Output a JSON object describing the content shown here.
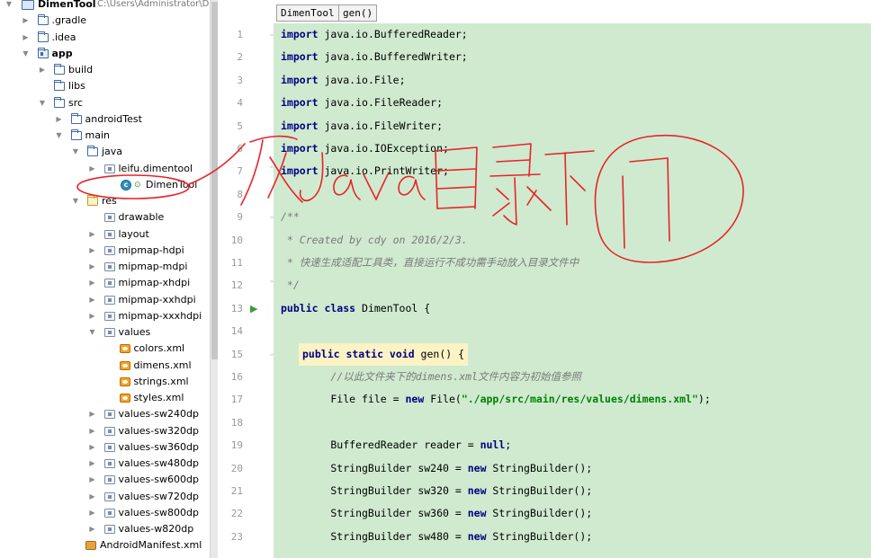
{
  "project_tree": {
    "root": {
      "label": "DimenTool",
      "path": "C:\\Users\\Administrator\\De"
    },
    "items": [
      {
        "label": ".gradle",
        "depth": 1,
        "icon": "folder-icon",
        "expanded": false
      },
      {
        "label": ".idea",
        "depth": 1,
        "icon": "folder-icon",
        "expanded": false
      },
      {
        "label": "app",
        "depth": 1,
        "icon": "module-folder-icon",
        "expanded": true,
        "bold": true
      },
      {
        "label": "build",
        "depth": 2,
        "icon": "folder-icon",
        "expanded": false
      },
      {
        "label": "libs",
        "depth": 2,
        "icon": "folder-icon",
        "expanded": null
      },
      {
        "label": "src",
        "depth": 2,
        "icon": "folder-icon",
        "expanded": true
      },
      {
        "label": "androidTest",
        "depth": 3,
        "icon": "folder-icon",
        "expanded": false
      },
      {
        "label": "main",
        "depth": 3,
        "icon": "folder-icon",
        "expanded": true
      },
      {
        "label": "java",
        "depth": 4,
        "icon": "folder-icon",
        "expanded": true
      },
      {
        "label": "leifu.dimentool",
        "depth": 5,
        "icon": "package-icon",
        "expanded": false
      },
      {
        "label": "DimenTool",
        "depth": 6,
        "icon": "class-icon",
        "expanded": null
      },
      {
        "label": "res",
        "depth": 4,
        "icon": "res-folder-icon",
        "expanded": true
      },
      {
        "label": "drawable",
        "depth": 5,
        "icon": "package-icon",
        "expanded": null
      },
      {
        "label": "layout",
        "depth": 5,
        "icon": "package-icon",
        "expanded": false
      },
      {
        "label": "mipmap-hdpi",
        "depth": 5,
        "icon": "package-icon",
        "expanded": false
      },
      {
        "label": "mipmap-mdpi",
        "depth": 5,
        "icon": "package-icon",
        "expanded": false
      },
      {
        "label": "mipmap-xhdpi",
        "depth": 5,
        "icon": "package-icon",
        "expanded": false
      },
      {
        "label": "mipmap-xxhdpi",
        "depth": 5,
        "icon": "package-icon",
        "expanded": false
      },
      {
        "label": "mipmap-xxxhdpi",
        "depth": 5,
        "icon": "package-icon",
        "expanded": false
      },
      {
        "label": "values",
        "depth": 5,
        "icon": "package-icon",
        "expanded": true
      },
      {
        "label": "colors.xml",
        "depth": 7,
        "icon": "xml-file-icon",
        "expanded": null
      },
      {
        "label": "dimens.xml",
        "depth": 7,
        "icon": "xml-file-icon",
        "expanded": null
      },
      {
        "label": "strings.xml",
        "depth": 7,
        "icon": "xml-file-icon",
        "expanded": null
      },
      {
        "label": "styles.xml",
        "depth": 7,
        "icon": "xml-file-icon",
        "expanded": null
      },
      {
        "label": "values-sw240dp",
        "depth": 5,
        "icon": "package-icon",
        "expanded": false
      },
      {
        "label": "values-sw320dp",
        "depth": 5,
        "icon": "package-icon",
        "expanded": false
      },
      {
        "label": "values-sw360dp",
        "depth": 5,
        "icon": "package-icon",
        "expanded": false
      },
      {
        "label": "values-sw480dp",
        "depth": 5,
        "icon": "package-icon",
        "expanded": false
      },
      {
        "label": "values-sw600dp",
        "depth": 5,
        "icon": "package-icon",
        "expanded": false
      },
      {
        "label": "values-sw720dp",
        "depth": 5,
        "icon": "package-icon",
        "expanded": false
      },
      {
        "label": "values-sw800dp",
        "depth": 5,
        "icon": "package-icon",
        "expanded": false
      },
      {
        "label": "values-w820dp",
        "depth": 5,
        "icon": "package-icon",
        "expanded": false
      },
      {
        "label": "AndroidManifest.xml",
        "depth": 4,
        "icon": "manifest-file-icon",
        "expanded": null
      }
    ]
  },
  "breadcrumb": {
    "class_name": "DimenTool",
    "method_name": "gen()"
  },
  "editor": {
    "lines": [
      {
        "n": "1",
        "tokens": [
          [
            "kw",
            "import"
          ],
          [
            "",
            "java.io.BufferedReader;"
          ]
        ]
      },
      {
        "n": "2",
        "tokens": [
          [
            "kw",
            "import"
          ],
          [
            "",
            "java.io.BufferedWriter;"
          ]
        ]
      },
      {
        "n": "3",
        "tokens": [
          [
            "kw",
            "import"
          ],
          [
            "",
            "java.io.File;"
          ]
        ]
      },
      {
        "n": "4",
        "tokens": [
          [
            "kw",
            "import"
          ],
          [
            "",
            "java.io.FileReader;"
          ]
        ]
      },
      {
        "n": "5",
        "tokens": [
          [
            "kw",
            "import"
          ],
          [
            "",
            "java.io.FileWriter;"
          ]
        ]
      },
      {
        "n": "6",
        "tokens": [
          [
            "kw",
            "import"
          ],
          [
            "",
            "java.io.IOException;"
          ]
        ]
      },
      {
        "n": "7",
        "tokens": [
          [
            "kw",
            "import"
          ],
          [
            "",
            "java.io.PrintWriter;"
          ]
        ]
      },
      {
        "n": "8",
        "tokens": []
      },
      {
        "n": "9",
        "tokens": [
          [
            "cm",
            "/**"
          ]
        ]
      },
      {
        "n": "10",
        "tokens": [
          [
            "cm",
            " * Created by cdy on 2016/2/3."
          ]
        ]
      },
      {
        "n": "11",
        "tokens": [
          [
            "cm",
            " * 快速生成适配工具类，直接运行不成功需手动放入目录文件中"
          ]
        ]
      },
      {
        "n": "12",
        "tokens": [
          [
            "cm",
            " */"
          ]
        ]
      },
      {
        "n": "13",
        "tokens": [
          [
            "kw",
            "public class"
          ],
          [
            "",
            " DimenTool {"
          ]
        ]
      },
      {
        "n": "14",
        "tokens": []
      },
      {
        "n": "15",
        "tokens": [
          [
            "kw",
            "public static void"
          ],
          [
            "",
            " gen() {"
          ]
        ],
        "highlight": true
      },
      {
        "n": "16",
        "tokens": [
          [
            "",
            "        "
          ],
          [
            "cm",
            "//以此文件夹下的dimens.xml文件内容为初始值参照"
          ]
        ]
      },
      {
        "n": "17",
        "tokens": [
          [
            "",
            "        File file = "
          ],
          [
            "kw",
            "new"
          ],
          [
            "",
            " File("
          ],
          [
            "str",
            "\"./app/src/main/res/values/dimens.xml\""
          ],
          [
            "",
            ");"
          ]
        ]
      },
      {
        "n": "18",
        "tokens": []
      },
      {
        "n": "19",
        "tokens": [
          [
            "",
            "        BufferedReader reader = "
          ],
          [
            "kw",
            "null"
          ],
          [
            "",
            ";"
          ]
        ]
      },
      {
        "n": "20",
        "tokens": [
          [
            "",
            "        StringBuilder sw240 = "
          ],
          [
            "kw",
            "new"
          ],
          [
            "",
            " StringBuilder();"
          ]
        ]
      },
      {
        "n": "21",
        "tokens": [
          [
            "",
            "        StringBuilder sw320 = "
          ],
          [
            "kw",
            "new"
          ],
          [
            "",
            " StringBuilder();"
          ]
        ]
      },
      {
        "n": "22",
        "tokens": [
          [
            "",
            "        StringBuilder sw360 = "
          ],
          [
            "kw",
            "new"
          ],
          [
            "",
            " StringBuilder();"
          ]
        ]
      },
      {
        "n": "23",
        "tokens": [
          [
            "",
            "        StringBuilder sw480 = "
          ],
          [
            "kw",
            "new"
          ],
          [
            "",
            " StringBuilder();"
          ]
        ]
      }
    ]
  },
  "colors": {
    "editor_background": "#cfeacf",
    "keyword": "#000080",
    "comment": "#7a7a7a",
    "string": "#008000",
    "annotation_ink": "#e8232a"
  }
}
